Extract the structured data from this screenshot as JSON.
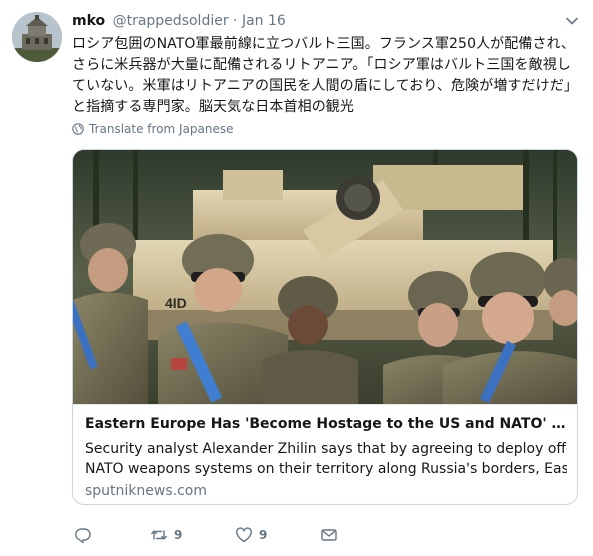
{
  "tweet": {
    "name": "mko",
    "handle": "@trappedsoldier",
    "separator": "·",
    "date": "Jan 16",
    "text_lines": [
      "ロシア包囲のNATO軍最前線に立つバルト三国。フランス軍250人が配備され、",
      "さらに米兵器が大量に配備されるリトアニア。「ロシア軍はバルト三国を敵視し",
      "ていない。米軍はリトアニアの国民を人間の盾にしており、危険が増すだけだ」",
      "と指摘する専門家。脳天気な日本首相の観光"
    ],
    "translate_label": "Translate from Japanese"
  },
  "card": {
    "title": "Eastern Europe Has 'Become Hostage to the US and NATO' – Securit…",
    "description_lines": [
      "Security analyst Alexander Zhilin says that by agreeing to deploy offensive",
      "NATO weapons systems on their territory along Russia's borders, Eastern"
    ],
    "domain": "sputniknews.com",
    "tank_marking": "4ID"
  },
  "actions": {
    "retweet_count": "9",
    "like_count": "9"
  },
  "colors": {
    "text": "#14171a",
    "secondary": "#657786",
    "border": "#ccd6dd"
  },
  "icons": [
    "caret-down-icon",
    "globe-icon",
    "reply-icon",
    "retweet-icon",
    "like-icon",
    "dm-icon"
  ]
}
